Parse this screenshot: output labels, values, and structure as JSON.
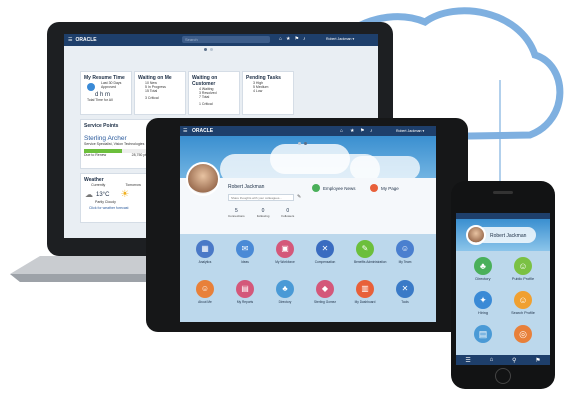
{
  "brand": {
    "logo": "ORACLE"
  },
  "colors": {
    "accent": "#4a90d9",
    "bar": "#1e3f6b",
    "cloud": "#7fb0e0"
  },
  "laptop": {
    "search_placeholder": "Search",
    "user_label": "Robert Jackman ▾",
    "cards": {
      "resume": {
        "title": "My Resume Time",
        "sub1": "Last 30 Days",
        "sub2": "Approved",
        "units": "d  h  m",
        "foot": "Total Time for All"
      },
      "waiting_me": {
        "title": "Waiting on Me",
        "rows": [
          "10  New",
          "5  In Progress",
          "15  Total",
          "3  Critical"
        ]
      },
      "waiting_customer": {
        "title": "Waiting on Customer",
        "rows": [
          "4  Waiting",
          "3  Resolved",
          "7  Total",
          "1  Critical"
        ]
      },
      "pending": {
        "title": "Pending Tasks",
        "rows": [
          "3  High",
          "5  Medium",
          "4  Low"
        ]
      },
      "service": {
        "title": "Service Points",
        "name": "Sterling Archer",
        "role": "Service Specialist, Vision Technologies",
        "bar_label": "Due to Renew",
        "bar_value": "28,750 pts"
      },
      "weather": {
        "title": "Weather",
        "col1": "Currently",
        "col2": "Tomorrow",
        "temp": "13°C",
        "cond": "Partly Cloudy",
        "link": "Click for weather forecast"
      }
    }
  },
  "tablet": {
    "user_label": "Robert Jackman ▾",
    "profile": {
      "name": "Robert Jackman",
      "share_placeholder": "Share thoughts with your colleagues...",
      "stats": [
        {
          "value": "5",
          "label": "Connections"
        },
        {
          "value": "0",
          "label": "Following"
        },
        {
          "value": "0",
          "label": "Followers"
        }
      ],
      "links": [
        {
          "label": "Employee News"
        },
        {
          "label": "My Page"
        }
      ]
    },
    "apps": [
      {
        "label": "Analytics",
        "color": "#4a79c7",
        "icon": "▦"
      },
      {
        "label": "Ideas",
        "color": "#4a8ad6",
        "icon": "✉"
      },
      {
        "label": "My Workforce",
        "color": "#d4587a",
        "icon": "▣"
      },
      {
        "label": "Compensation",
        "color": "#3a6cc0",
        "icon": "✕"
      },
      {
        "label": "Benefits Administration",
        "color": "#6cbf3c",
        "icon": "✎"
      },
      {
        "label": "My Team",
        "color": "#4a7fcf",
        "icon": "☺"
      },
      {
        "label": "About Me",
        "color": "#e8803a",
        "icon": "☺"
      },
      {
        "label": "My Reports",
        "color": "#d4587a",
        "icon": "▤"
      },
      {
        "label": "Directory",
        "color": "#4a9ad6",
        "icon": "♣"
      },
      {
        "label": "Sterling Gomez",
        "color": "#d4587a",
        "icon": "◆"
      },
      {
        "label": "My Dashboard",
        "color": "#e8603a",
        "icon": "▥"
      },
      {
        "label": "Tools",
        "color": "#3a7ac7",
        "icon": "✕"
      }
    ]
  },
  "phone": {
    "name": "Robert Jackman",
    "apps": [
      {
        "label": "Directory",
        "color": "#4ab05a",
        "icon": "♣"
      },
      {
        "label": "Public Profile",
        "color": "#7bc143",
        "icon": "☺"
      },
      {
        "label": "Hiring",
        "color": "#3a8ad6",
        "icon": "✦"
      },
      {
        "label": "Search Profile",
        "color": "#f0a030",
        "icon": "☺"
      },
      {
        "label": "",
        "color": "#4a9ad6",
        "icon": "▤"
      },
      {
        "label": "",
        "color": "#e8803a",
        "icon": "◎"
      }
    ]
  }
}
